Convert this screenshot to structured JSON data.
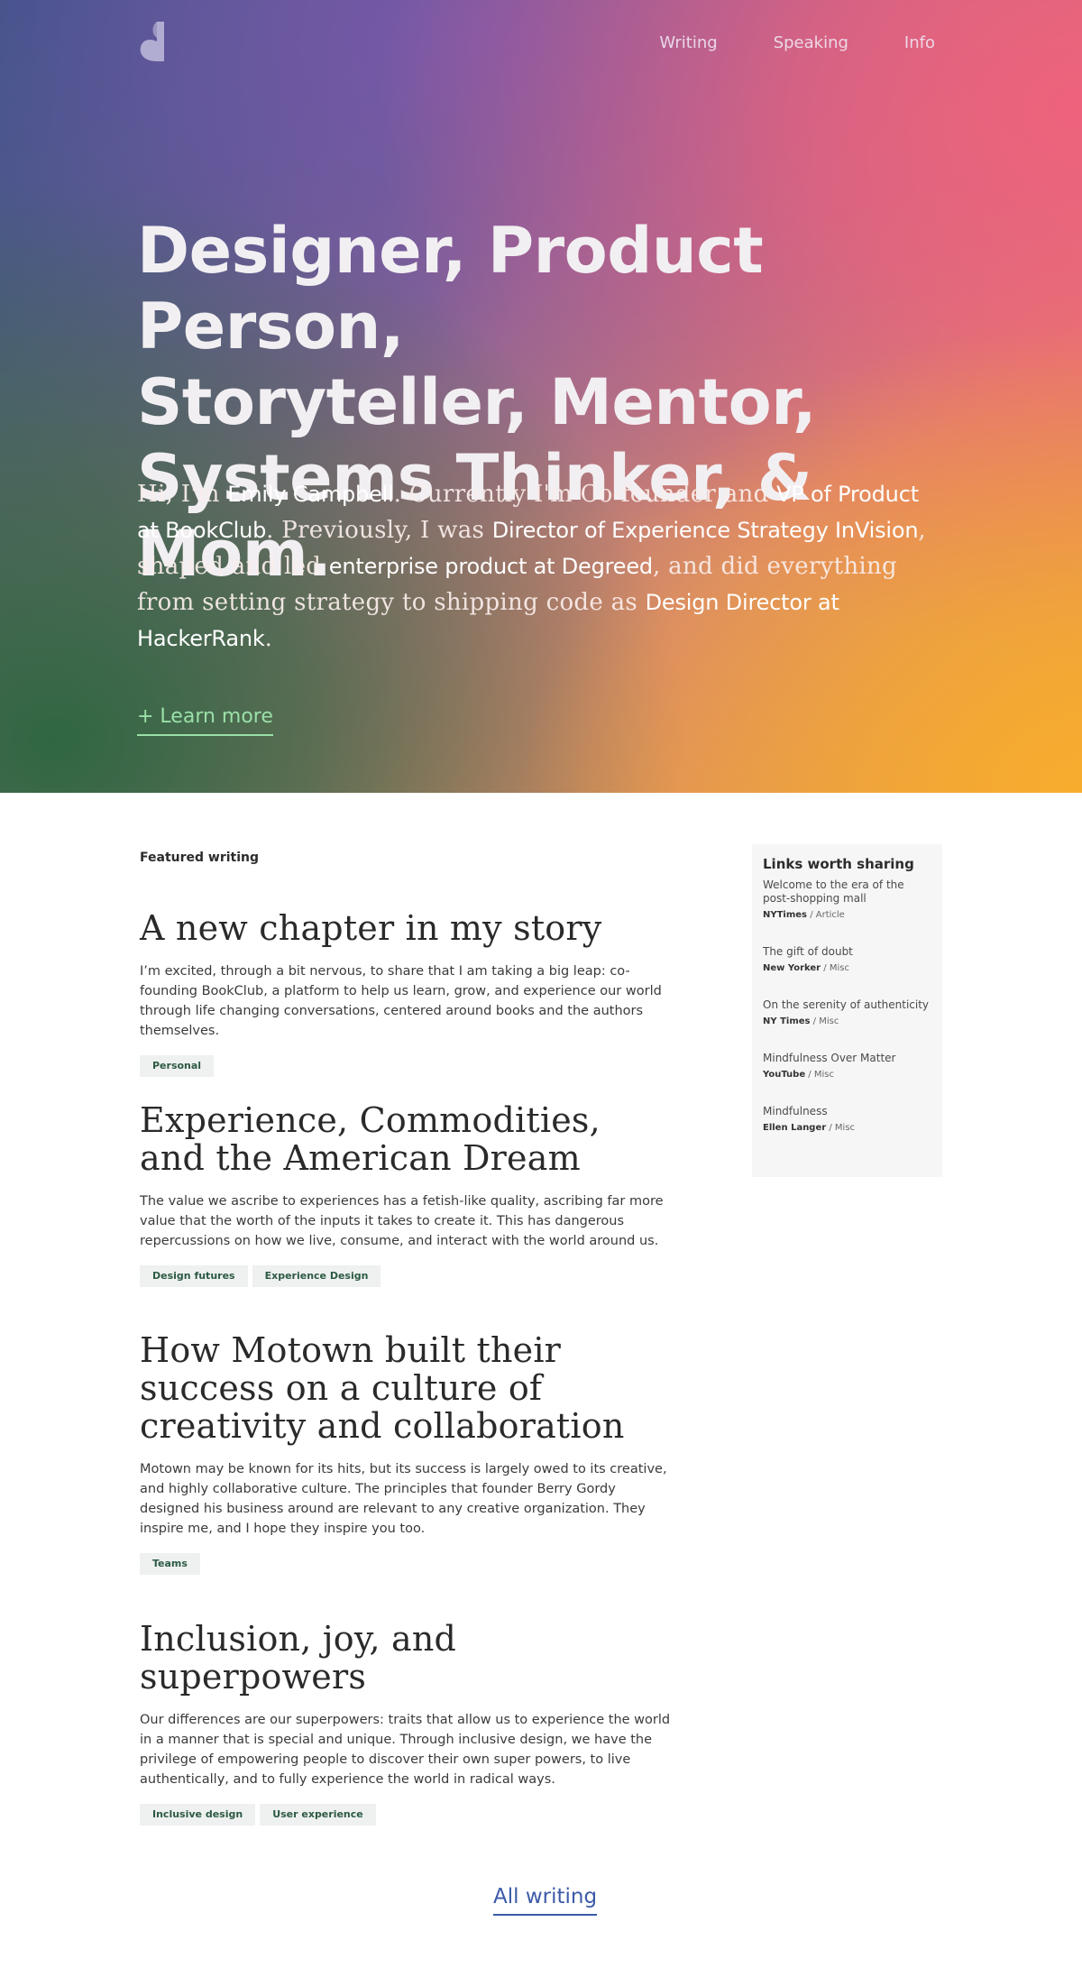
{
  "nav": {
    "logo_icon": "brand-leaf-logo",
    "items": [
      "Writing",
      "Speaking",
      "Info"
    ]
  },
  "hero": {
    "headline": [
      "Designer, Product Person,",
      "Storyteller, Mentor,",
      "Systems Thinker, & Mom."
    ],
    "bio": {
      "p1": "Hi, I'm ",
      "name": "Emily Campbell",
      "p2": ". Currently I'm Co-founder and ",
      "vp": "VP of Product at BookClub",
      "p3": ". Previously, I was ",
      "invision": "Director of Experience Strategy InVision",
      "p4": ", shaped and led ",
      "degreed": "enterprise product at Degreed",
      "p5": ", and did everything from setting strategy to shipping code as ",
      "hackerrank": "Design Director at HackerRank",
      "p6": "."
    },
    "learn_more": "+ Learn more"
  },
  "featured": {
    "label": "Featured writing",
    "articles": [
      {
        "title": "A new chapter in my story",
        "excerpt": "I’m excited, through a bit nervous, to share that I am taking a big leap: co-founding BookClub, a platform to help us learn, grow, and experience our world through life changing conversations, centered around books and the authors themselves.",
        "tags": [
          "Personal"
        ]
      },
      {
        "title": "Experience, Commodities, and the American Dream",
        "excerpt": "The value we ascribe to experiences has a fetish-like quality, ascribing far more value that the worth of the inputs it takes to create it. This has dangerous repercussions on how we live, consume, and interact with the world around us.",
        "tags": [
          "Design futures",
          "Experience Design"
        ]
      },
      {
        "title": "How Motown built their success on a culture of creativity and collaboration",
        "excerpt": "Motown may be known for its hits, but its success is largely owed to its creative, and highly collaborative culture. The principles that founder Berry Gordy designed his business around are relevant to any creative organization. They inspire me, and I hope they inspire you too.",
        "tags": [
          "Teams"
        ]
      },
      {
        "title": "Inclusion, joy, and superpowers",
        "excerpt": "Our differences are our superpowers: traits that allow us to experience the world in a manner that is special and unique. Through inclusive design, we have the privilege of empowering people to discover their own super powers, to live authentically, and to fully experience the world in radical ways.",
        "tags": [
          "Inclusive design",
          "User experience"
        ]
      }
    ],
    "all_writing": "All writing"
  },
  "links": {
    "title": "Links worth sharing",
    "items": [
      {
        "title": "Welcome to the era of the post-shopping mall",
        "source": "NYTimes",
        "type": "Article"
      },
      {
        "title": "The gift of doubt",
        "source": "New Yorker",
        "type": "Misc"
      },
      {
        "title": "On the serenity of authenticity",
        "source": "NY Times",
        "type": "Misc"
      },
      {
        "title": "Mindfulness Over Matter",
        "source": "YouTube",
        "type": "Misc"
      },
      {
        "title": "Mindfulness",
        "source": "Ellen Langer",
        "type": "Misc"
      }
    ]
  },
  "colors": {
    "learn_more": "#9ae0a8",
    "all_writing": "#3c5aa8",
    "tag_text": "#2d5a43",
    "tag_bg": "#eef1f0"
  }
}
